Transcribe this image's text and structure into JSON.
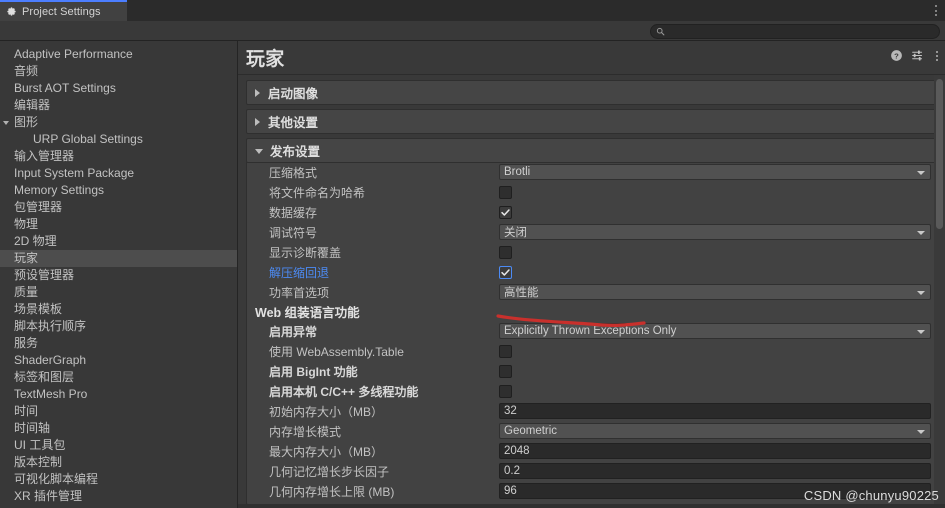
{
  "window": {
    "tab_label": "Project Settings",
    "tab_icon": "gear-icon",
    "overflow_icon": "vertical-dots-icon"
  },
  "search": {
    "placeholder": "",
    "value": "",
    "icon": "search-icon"
  },
  "sidebar": {
    "items": [
      {
        "label": "Adaptive Performance",
        "indent": false,
        "arrow": "",
        "selected": false
      },
      {
        "label": "音频",
        "indent": false,
        "arrow": "",
        "selected": false
      },
      {
        "label": "Burst AOT Settings",
        "indent": false,
        "arrow": "",
        "selected": false
      },
      {
        "label": "编辑器",
        "indent": false,
        "arrow": "",
        "selected": false
      },
      {
        "label": "图形",
        "indent": false,
        "arrow": "open",
        "selected": false
      },
      {
        "label": "URP Global Settings",
        "indent": true,
        "arrow": "",
        "selected": false
      },
      {
        "label": "输入管理器",
        "indent": false,
        "arrow": "",
        "selected": false
      },
      {
        "label": "Input System Package",
        "indent": false,
        "arrow": "",
        "selected": false
      },
      {
        "label": "Memory Settings",
        "indent": false,
        "arrow": "",
        "selected": false
      },
      {
        "label": "包管理器",
        "indent": false,
        "arrow": "",
        "selected": false
      },
      {
        "label": "物理",
        "indent": false,
        "arrow": "",
        "selected": false
      },
      {
        "label": "2D 物理",
        "indent": false,
        "arrow": "",
        "selected": false
      },
      {
        "label": "玩家",
        "indent": false,
        "arrow": "",
        "selected": true
      },
      {
        "label": "预设管理器",
        "indent": false,
        "arrow": "",
        "selected": false
      },
      {
        "label": "质量",
        "indent": false,
        "arrow": "",
        "selected": false
      },
      {
        "label": "场景模板",
        "indent": false,
        "arrow": "",
        "selected": false
      },
      {
        "label": "脚本执行顺序",
        "indent": false,
        "arrow": "",
        "selected": false
      },
      {
        "label": "服务",
        "indent": false,
        "arrow": "",
        "selected": false
      },
      {
        "label": "ShaderGraph",
        "indent": false,
        "arrow": "",
        "selected": false
      },
      {
        "label": "标签和图层",
        "indent": false,
        "arrow": "",
        "selected": false
      },
      {
        "label": "TextMesh Pro",
        "indent": false,
        "arrow": "",
        "selected": false
      },
      {
        "label": "时间",
        "indent": false,
        "arrow": "",
        "selected": false
      },
      {
        "label": "时间轴",
        "indent": false,
        "arrow": "",
        "selected": false
      },
      {
        "label": "UI 工具包",
        "indent": false,
        "arrow": "",
        "selected": false
      },
      {
        "label": "版本控制",
        "indent": false,
        "arrow": "",
        "selected": false
      },
      {
        "label": "可视化脚本编程",
        "indent": false,
        "arrow": "",
        "selected": false
      },
      {
        "label": "XR 插件管理",
        "indent": false,
        "arrow": "",
        "selected": false
      }
    ]
  },
  "main": {
    "title": "玩家",
    "header_icons": [
      {
        "name": "help-icon"
      },
      {
        "name": "preset-icon"
      },
      {
        "name": "more-options-icon"
      }
    ],
    "foldouts": [
      {
        "label": "启动图像",
        "open": false
      },
      {
        "label": "其他设置",
        "open": false
      },
      {
        "label": "发布设置",
        "open": true
      }
    ],
    "publishing_rows": [
      {
        "label": "压缩格式",
        "type": "popup",
        "value": "Brotli",
        "checked": false,
        "highlight": false,
        "focused": false
      },
      {
        "label": "将文件命名为哈希",
        "type": "checkbox",
        "value": "",
        "checked": false,
        "highlight": false,
        "focused": false
      },
      {
        "label": "数据缓存",
        "type": "checkbox",
        "value": "",
        "checked": true,
        "highlight": false,
        "focused": false
      },
      {
        "label": "调试符号",
        "type": "popup",
        "value": "关闭",
        "checked": false,
        "highlight": false,
        "focused": false
      },
      {
        "label": "显示诊断覆盖",
        "type": "checkbox",
        "value": "",
        "checked": false,
        "highlight": false,
        "focused": false
      },
      {
        "label": "解压缩回退",
        "type": "checkbox",
        "value": "",
        "checked": true,
        "highlight": true,
        "focused": true
      },
      {
        "label": "功率首选项",
        "type": "popup",
        "value": "高性能",
        "checked": false,
        "highlight": false,
        "focused": false
      }
    ],
    "wasm_group_label": "Web 组装语言功能",
    "wasm_rows": [
      {
        "label": "启用异常",
        "type": "popup",
        "value": "Explicitly Thrown Exceptions Only",
        "checked": false,
        "bold": true
      },
      {
        "label": "使用 WebAssembly.Table",
        "type": "checkbox",
        "value": "",
        "checked": false,
        "bold": false
      },
      {
        "label": "启用 BigInt 功能",
        "type": "checkbox",
        "value": "",
        "checked": false,
        "bold": true
      },
      {
        "label": "启用本机 C/C++ 多线程功能",
        "type": "checkbox",
        "value": "",
        "checked": false,
        "bold": true
      },
      {
        "label": "初始内存大小（MB）",
        "type": "text",
        "value": "32",
        "checked": false,
        "bold": false
      },
      {
        "label": "内存增长模式",
        "type": "popup",
        "value": "Geometric",
        "checked": false,
        "bold": false
      },
      {
        "label": "最大内存大小（MB）",
        "type": "text",
        "value": "2048",
        "checked": false,
        "bold": false
      },
      {
        "label": "几何记忆增长步长因子",
        "type": "text",
        "value": "0.2",
        "checked": false,
        "bold": false
      },
      {
        "label": "几何内存增长上限 (MB)",
        "type": "text",
        "value": "96",
        "checked": false,
        "bold": false
      }
    ]
  },
  "watermark": "CSDN @chunyu90225",
  "colors": {
    "accent_blue": "#4c8bf5",
    "tab_accent": "#4c7eff",
    "annotation_red": "#c9302c",
    "panel_bg": "#393939",
    "section_bg": "#424242",
    "header_bg": "#454545",
    "selected_row": "#4d4d4d"
  }
}
